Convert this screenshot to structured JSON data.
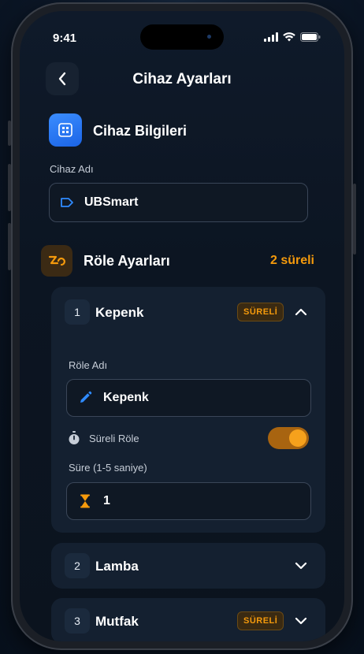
{
  "status_bar": {
    "time": "9:41"
  },
  "header": {
    "title": "Cihaz Ayarları"
  },
  "device_info": {
    "section_title": "Cihaz Bilgileri",
    "name_label": "Cihaz Adı",
    "name_value": "UBSmart"
  },
  "relay_settings": {
    "section_title": "Röle Ayarları",
    "timed_count": "2 süreli",
    "relays": [
      {
        "number": "1",
        "name": "Kepenk",
        "badge": "SÜRELİ",
        "expanded": true,
        "name_label": "Röle Adı",
        "name_value": "Kepenk",
        "timed_label": "Süreli Röle",
        "timed_on": true,
        "duration_label": "Süre (1-5 saniye)",
        "duration_value": "1"
      },
      {
        "number": "2",
        "name": "Lamba",
        "expanded": false
      },
      {
        "number": "3",
        "name": "Mutfak",
        "badge": "SÜRELİ",
        "expanded": false
      }
    ]
  },
  "colors": {
    "accent_orange": "#f59a0c",
    "accent_blue": "#1e7bff",
    "card_bg": "#142030",
    "screen_bg": "#0c1522"
  },
  "icons": {
    "back": "chevron-left-icon",
    "device": "grid-chip-icon",
    "device_name": "tag-icon",
    "relay": "relay-icon",
    "edit": "pencil-icon",
    "timer": "stopwatch-icon",
    "duration": "hourglass-icon"
  }
}
